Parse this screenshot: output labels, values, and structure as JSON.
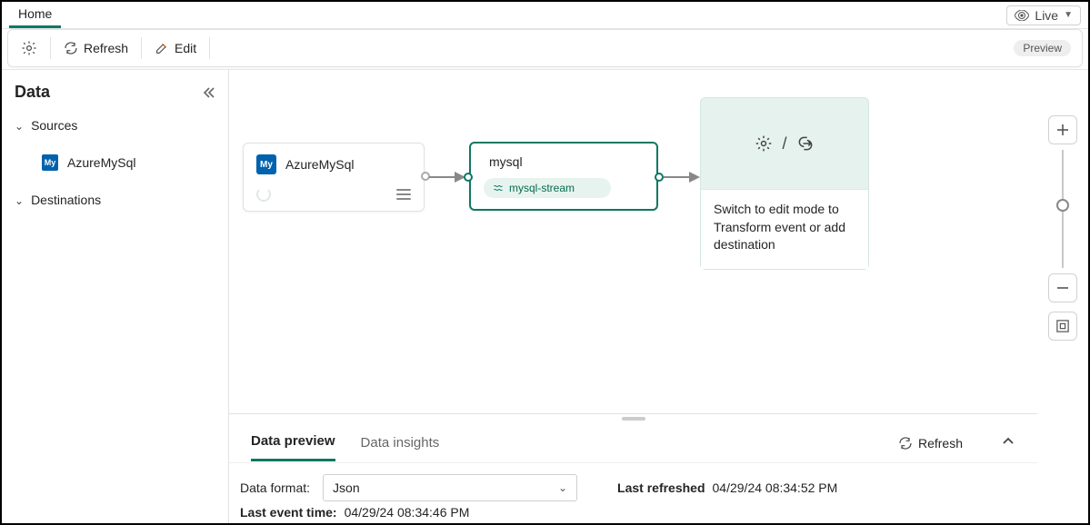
{
  "topbar": {
    "home_label": "Home",
    "live_label": "Live"
  },
  "toolbar": {
    "refresh_label": "Refresh",
    "edit_label": "Edit",
    "preview_badge": "Preview"
  },
  "sidebar": {
    "title": "Data",
    "groups": {
      "sources_label": "Sources",
      "destinations_label": "Destinations"
    },
    "source_item_label": "AzureMySql"
  },
  "nodes": {
    "source": {
      "title": "AzureMySql"
    },
    "stream": {
      "title": "mysql",
      "pill": "mysql-stream"
    },
    "dest": {
      "icon_sep": "/",
      "message": "Switch to edit mode to Transform event or add destination"
    }
  },
  "data_panel": {
    "tab_preview": "Data preview",
    "tab_insights": "Data insights",
    "refresh_label": "Refresh",
    "format_label": "Data format:",
    "format_value": "Json",
    "format_options": [
      "Json"
    ],
    "last_refreshed_label": "Last refreshed",
    "last_refreshed_value": "04/29/24 08:34:52 PM",
    "last_event_label": "Last event time:",
    "last_event_value": "04/29/24 08:34:46 PM"
  }
}
